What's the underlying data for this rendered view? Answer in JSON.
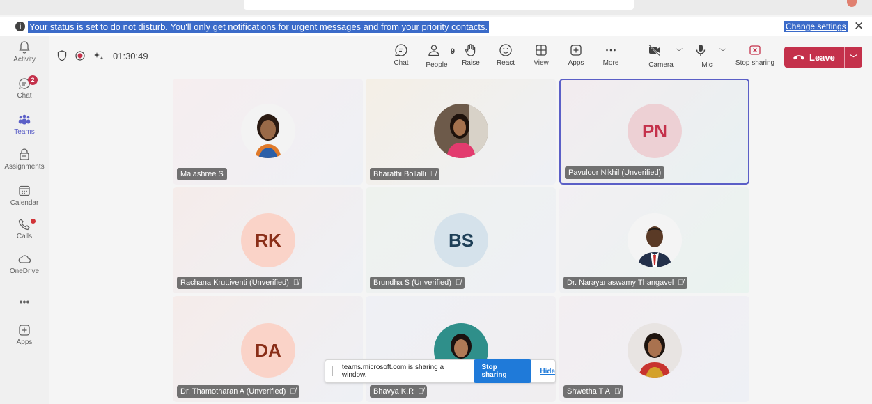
{
  "banner": {
    "message": "Your status is set to do not disturb. You'll only get notifications for urgent messages and from your priority contacts.",
    "change_settings": "Change settings"
  },
  "rail": {
    "items": [
      {
        "label": "Activity",
        "icon": "bell-icon"
      },
      {
        "label": "Chat",
        "icon": "chat-icon",
        "badge": "2"
      },
      {
        "label": "Teams",
        "icon": "teams-icon"
      },
      {
        "label": "Assignments",
        "icon": "assignments-icon"
      },
      {
        "label": "Calendar",
        "icon": "calendar-icon"
      },
      {
        "label": "Calls",
        "icon": "phone-icon"
      },
      {
        "label": "OneDrive",
        "icon": "cloud-icon"
      },
      {
        "label": "Apps",
        "icon": "plus-box-icon"
      }
    ],
    "more": "•••"
  },
  "toolbar": {
    "timer": "01:30:49",
    "people_count": "9",
    "buttons": [
      "Chat",
      "People",
      "Raise",
      "React",
      "View",
      "Apps",
      "More",
      "Camera",
      "Mic",
      "Stop sharing"
    ],
    "leave": "Leave"
  },
  "participants": [
    {
      "name": "Malashree S",
      "initials": "",
      "muted": false
    },
    {
      "name": "Bharathi Bollalli",
      "initials": "",
      "muted": true
    },
    {
      "name": "Pavuloor Nikhil (Unverified)",
      "initials": "PN",
      "muted": false,
      "color": "#edd0d4",
      "text_color": "#c4314b"
    },
    {
      "name": "Rachana Kruttiventi (Unverified)",
      "initials": "RK",
      "muted": true,
      "color": "#fad3c8",
      "text_color": "#8a2e18"
    },
    {
      "name": "Brundha S (Unverified)",
      "initials": "BS",
      "muted": true,
      "color": "#d5e2eb",
      "text_color": "#1e3f57"
    },
    {
      "name": "Dr. Narayanaswamy Thangavel",
      "initials": "",
      "muted": true
    },
    {
      "name": "Dr. Thamotharan A (Unverified)",
      "initials": "DA",
      "muted": true,
      "color": "#fad3c8",
      "text_color": "#8a2e18"
    },
    {
      "name": "Bhavya K.R",
      "initials": "",
      "muted": true
    },
    {
      "name": "Shwetha T A",
      "initials": "",
      "muted": true
    }
  ],
  "share_bar": {
    "message": "teams.microsoft.com is sharing a window.",
    "stop": "Stop sharing",
    "hide": "Hide"
  }
}
